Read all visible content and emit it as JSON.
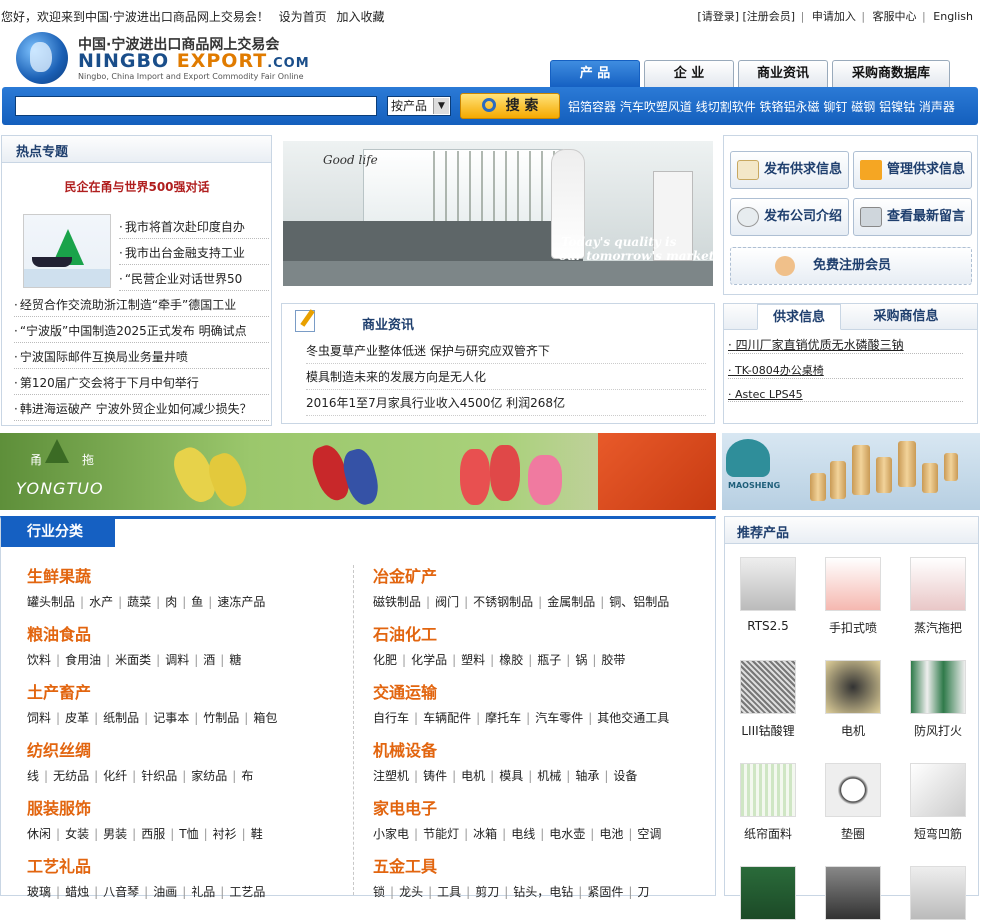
{
  "topbar": {
    "welcome": "您好，欢迎来到中国·宁波进出口商品网上交易会！",
    "set_home": "设为首页",
    "favorite": "加入收藏",
    "login": "[请登录]",
    "register": "[注册会员]",
    "apply": "申请加入",
    "service": "客服中心",
    "english": "English"
  },
  "logo": {
    "title_cn": "中国·宁波进出口商品网上交易会",
    "brand_a": "NINGBO",
    "brand_b": "EXPORT",
    "brand_c": ".COM",
    "subtitle": "Ningbo, China Import and Export Commodity Fair Online"
  },
  "tabs": [
    "产 品",
    "企 业",
    "商业资讯",
    "采购商数据库"
  ],
  "search": {
    "select_value": "按产品",
    "button": "搜 索",
    "hotwords": [
      "铝箔容器",
      "汽车吹塑风道",
      "线切割软件",
      "铁铬铝永磁",
      "铆钉",
      "磁钢",
      "铝镍钴",
      "消声器"
    ]
  },
  "hot": {
    "title": "热点专题",
    "feature": "民企在甬与世界500强对话",
    "thumb_items": [
      "我市将首次赴印度自办",
      "我市出台金融支持工业",
      "“民营企业对话世界50"
    ],
    "items": [
      "经贸合作交流助浙江制造“牵手”德国工业",
      "“宁波版”中国制造2025正式发布 明确试点",
      "宁波国际邮件互换局业务量井喷",
      "第120届广交会将于下月中旬举行",
      "韩进海运破产 宁波外贸企业如何减少损失？"
    ]
  },
  "banner1": {
    "slogan_script": "Good life",
    "quote_line1": "Today's quality is",
    "quote_line2": "our tomorrow's market"
  },
  "news": {
    "title": "商业资讯",
    "items": [
      "冬虫夏草产业整体低迷 保护与研究应双管齐下",
      "模具制造未来的发展方向是无人化",
      "2016年1至7月家具行业收入4500亿 利润268亿"
    ]
  },
  "actions": {
    "publish_supply": "发布供求信息",
    "manage_supply": "管理供求信息",
    "publish_company": "发布公司介绍",
    "view_messages": "查看最新留言",
    "free_register": "免费注册会员"
  },
  "supply": {
    "tab1": "供求信息",
    "tab2": "采购商信息",
    "items": [
      "四川厂家直销优质无水磷酸三钠",
      "TK-0804办公桌椅",
      " Astec LPS45"
    ]
  },
  "banner2": {
    "cn_a": "甬",
    "cn_b": "拖",
    "brand": "YONGTUO"
  },
  "banner3": {
    "brand": "MAOSHENG"
  },
  "categories": {
    "title": "行业分类",
    "left": [
      {
        "name": "生鲜果蔬",
        "items": [
          "罐头制品",
          "水产",
          "蔬菜",
          "肉",
          "鱼",
          "速冻产品"
        ]
      },
      {
        "name": "粮油食品",
        "items": [
          "饮料",
          "食用油",
          "米面类",
          "调料",
          "酒",
          "糖"
        ]
      },
      {
        "name": "土产畜产",
        "items": [
          "饲料",
          "皮革",
          "纸制品",
          "记事本",
          "竹制品",
          "箱包"
        ]
      },
      {
        "name": "纺织丝绸",
        "items": [
          "线",
          "无纺品",
          "化纤",
          "针织品",
          "家纺品",
          "布"
        ]
      },
      {
        "name": "服装服饰",
        "items": [
          "休闲",
          "女装",
          "男装",
          "西服",
          "T恤",
          "衬衫",
          "鞋"
        ]
      },
      {
        "name": "工艺礼品",
        "items": [
          "玻璃",
          "蜡烛",
          "八音琴",
          "油画",
          "礼品",
          "工艺品"
        ]
      }
    ],
    "right": [
      {
        "name": "冶金矿产",
        "items": [
          "磁铁制品",
          "阀门",
          "不锈钢制品",
          "金属制品",
          "铜、铝制品"
        ]
      },
      {
        "name": "石油化工",
        "items": [
          "化肥",
          "化学品",
          "塑料",
          "橡胶",
          "瓶子",
          "锅",
          "胶带"
        ]
      },
      {
        "name": "交通运输",
        "items": [
          "自行车",
          "车辆配件",
          "摩托车",
          "汽车零件",
          "其他交通工具"
        ]
      },
      {
        "name": "机械设备",
        "items": [
          "注塑机",
          "铸件",
          "电机",
          "模具",
          "机械",
          "轴承",
          "设备"
        ]
      },
      {
        "name": "家电电子",
        "items": [
          "小家电",
          "节能灯",
          "冰箱",
          "电线",
          "电水壶",
          "电池",
          "空调"
        ]
      },
      {
        "name": "五金工具",
        "items": [
          "锁",
          "龙头",
          "工具",
          "剪刀",
          "钻头，电钻",
          "紧固件",
          "刀"
        ]
      }
    ]
  },
  "recommend": {
    "title": "推荐产品",
    "items": [
      "RTS2.5",
      "手扣式喷",
      "蒸汽拖把",
      "LIII钴酸锂",
      "电机",
      "防风打火",
      "纸帘面料",
      "垫圈",
      "短弯凹筋"
    ]
  }
}
